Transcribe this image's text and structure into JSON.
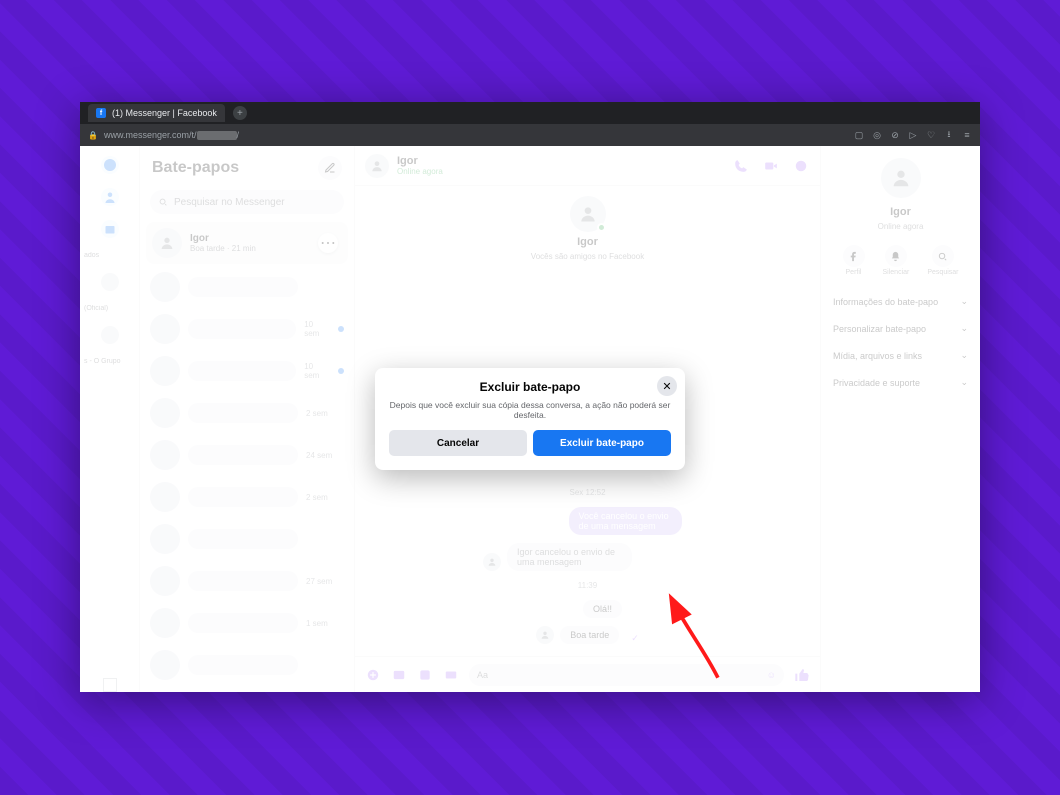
{
  "browser": {
    "tab_title": "(1) Messenger | Facebook",
    "url_prefix": "www.messenger.com/t/"
  },
  "farleft": {
    "labels": [
      "ados",
      "(Oficial)",
      "s - O Grupo"
    ]
  },
  "chatlist": {
    "title": "Bate-papos",
    "search_placeholder": "Pesquisar no Messenger",
    "active": {
      "name": "Igor",
      "sub": "Boa tarde · 21 min"
    },
    "rows": [
      {
        "time": ""
      },
      {
        "time": "10 sem",
        "unread": true
      },
      {
        "time": "10 sem",
        "unread": true
      },
      {
        "time": "2 sem"
      },
      {
        "time": "24 sem"
      },
      {
        "time": "2 sem"
      },
      {
        "time": ""
      },
      {
        "time": "27 sem"
      },
      {
        "time": "1 sem"
      },
      {
        "time": ""
      }
    ]
  },
  "thread": {
    "name": "Igor",
    "status": "Online agora",
    "center_name": "Igor",
    "center_sub": "Vocês são amigos no Facebook",
    "timestamp1": "Sex 12:52",
    "unsent_right": "Você cancelou o envio de uma mensagem",
    "unsent_left": "Igor cancelou o envio de uma mensagem",
    "timestamp2": "11:39",
    "msg1": "Olá!!",
    "msg2": "Boa tarde",
    "input_placeholder": "Aa"
  },
  "rpanel": {
    "name": "Igor",
    "status": "Online agora",
    "action_profile": "Perfil",
    "action_mute": "Silenciar",
    "action_search": "Pesquisar",
    "sections": [
      "Informações do bate-papo",
      "Personalizar bate-papo",
      "Mídia, arquivos e links",
      "Privacidade e suporte"
    ]
  },
  "modal": {
    "title": "Excluir bate-papo",
    "body": "Depois que você excluir sua cópia dessa conversa, a ação não poderá ser desfeita.",
    "cancel": "Cancelar",
    "confirm": "Excluir bate-papo"
  }
}
